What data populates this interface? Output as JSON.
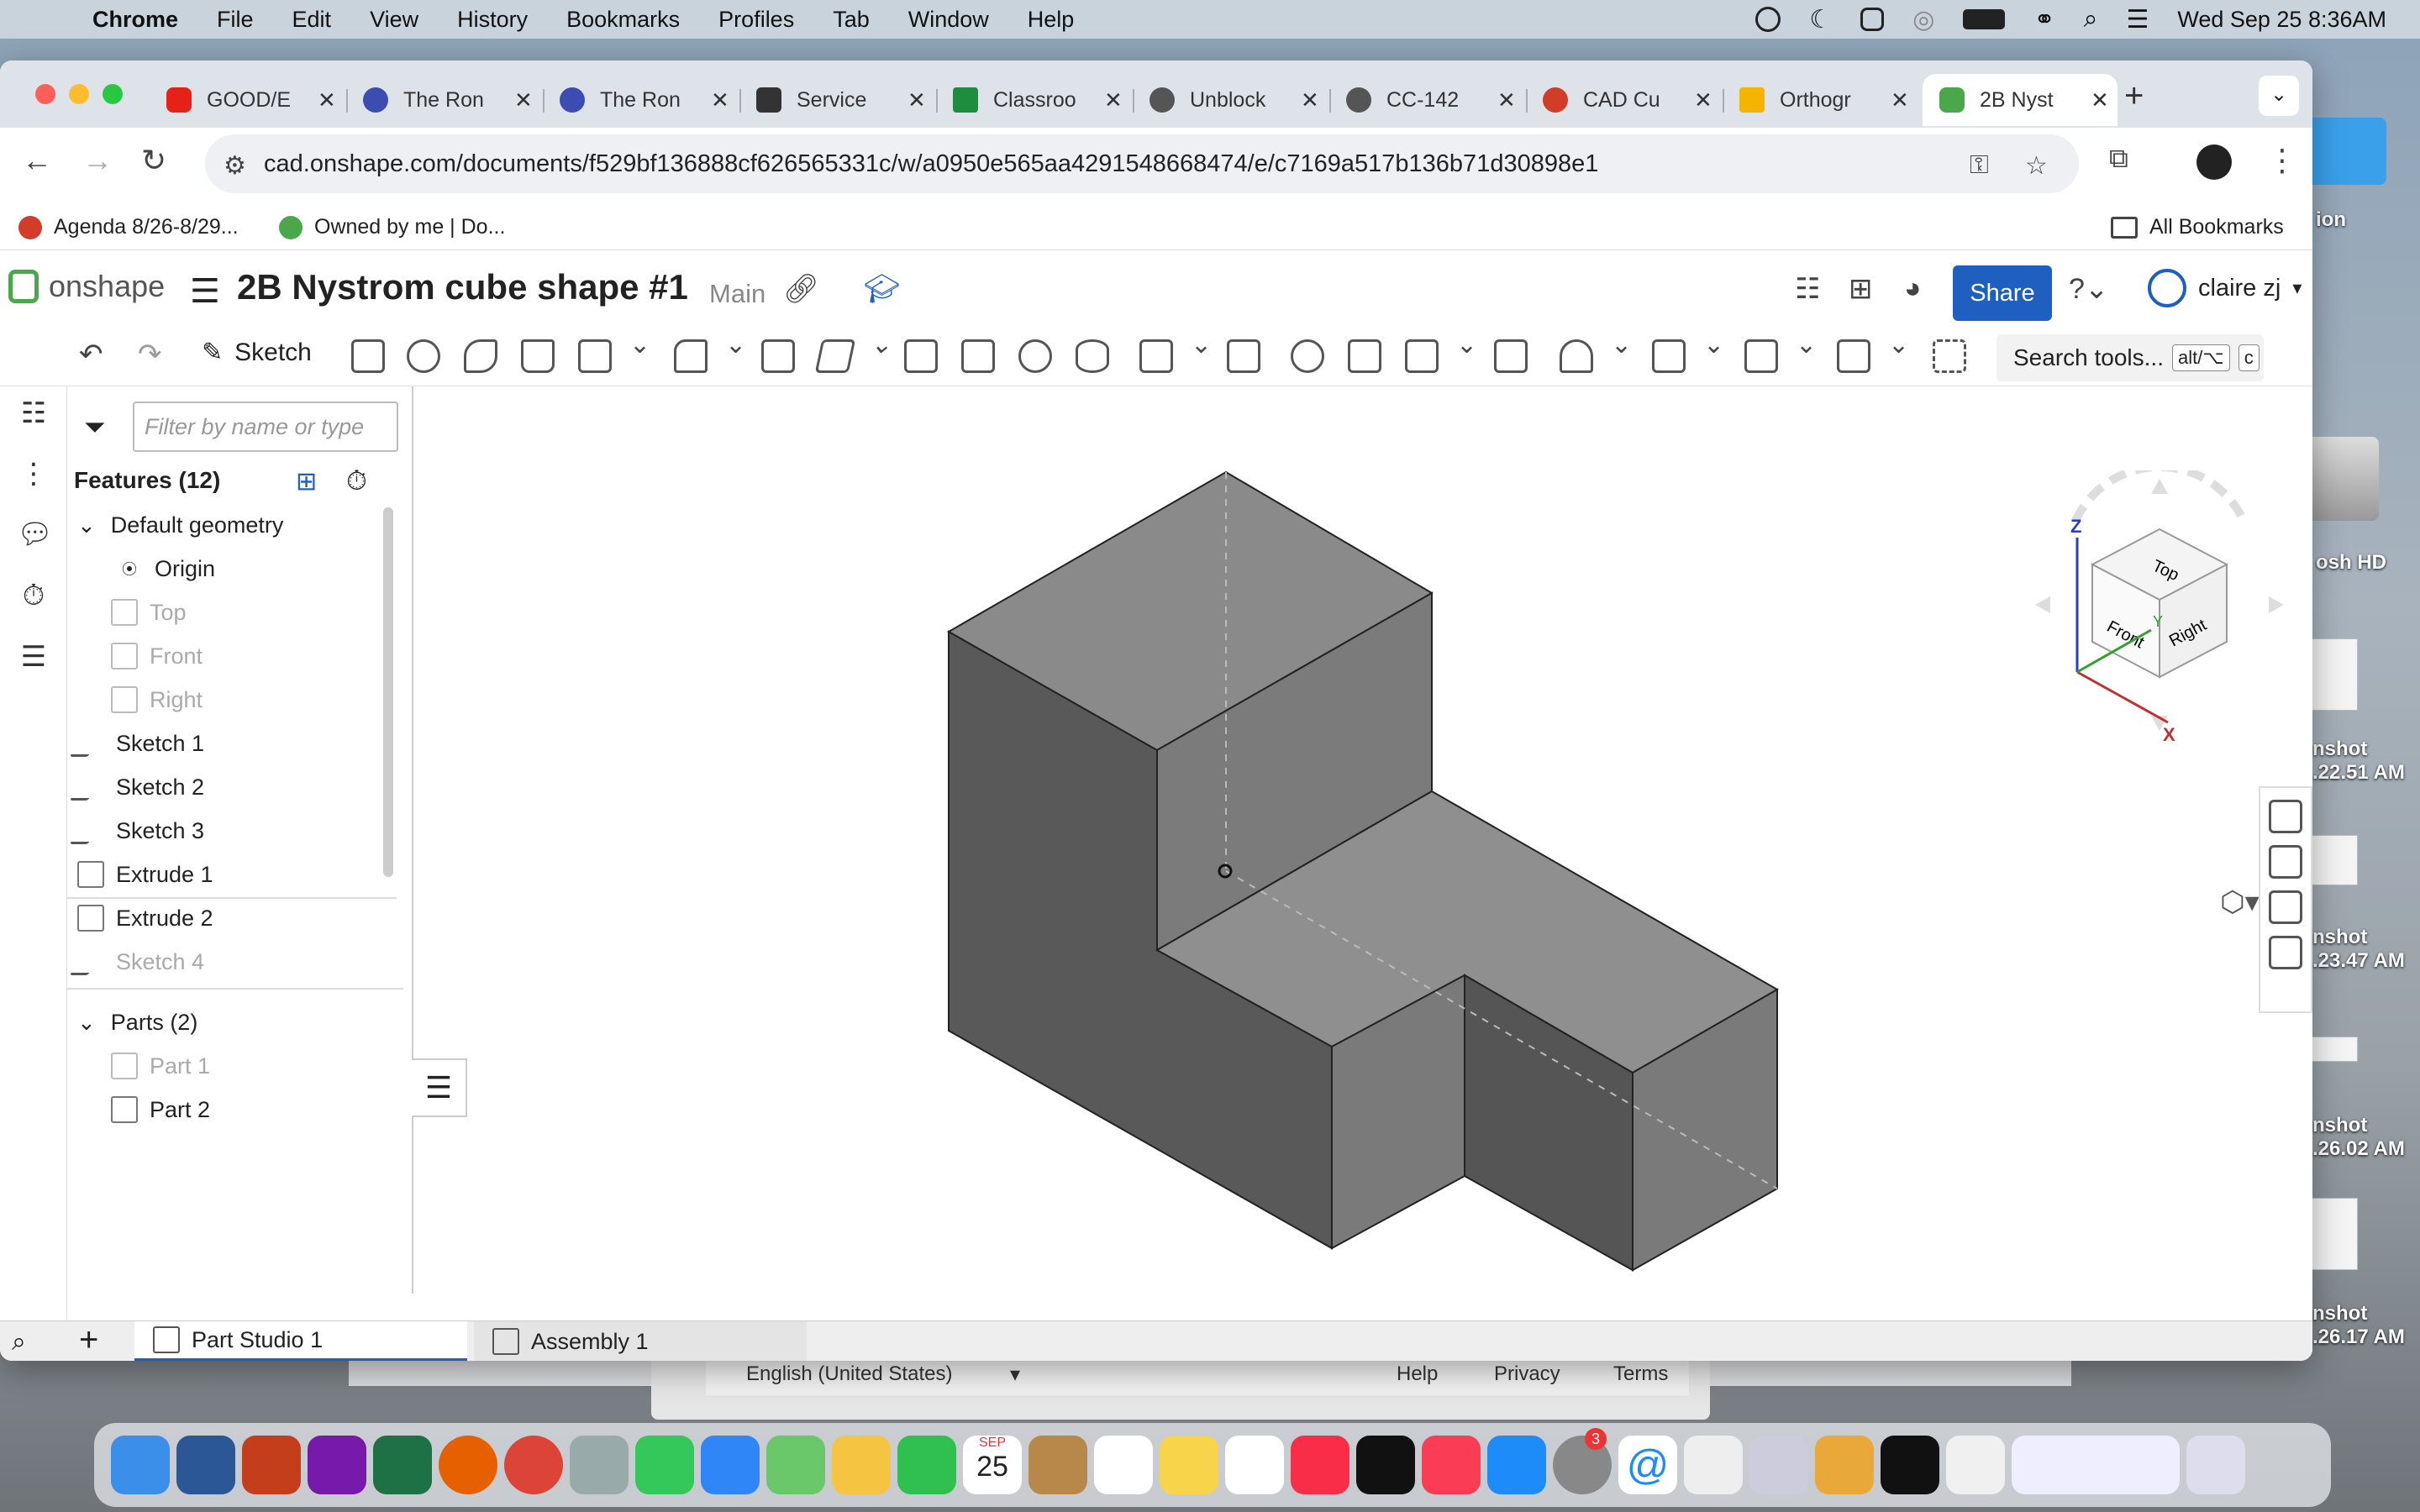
{
  "menubar": {
    "app_name": "Chrome",
    "items": [
      "File",
      "Edit",
      "View",
      "History",
      "Bookmarks",
      "Profiles",
      "Tab",
      "Window",
      "Help"
    ],
    "datetime": "Wed Sep 25  8:36AM"
  },
  "desktop": {
    "items": [
      {
        "label": "ion"
      },
      {
        "label": "osh HD"
      },
      {
        "label": "nshot\n.22.51 AM"
      },
      {
        "label": "nshot\n.23.47 AM"
      },
      {
        "label": "nshot\n.26.02 AM"
      },
      {
        "label": "nshot\n.26.17 AM"
      }
    ]
  },
  "behind_window": {
    "language": "English (United States)",
    "links": [
      "Help",
      "Privacy",
      "Terms"
    ]
  },
  "browser": {
    "tabs": [
      {
        "title": "GOOD/E",
        "color": "#e62117"
      },
      {
        "title": "The Ron",
        "color": "#3b4db0"
      },
      {
        "title": "The Ron",
        "color": "#3b4db0"
      },
      {
        "title": "Service",
        "color": "#333333"
      },
      {
        "title": "Classroo",
        "color": "#1e8e3e"
      },
      {
        "title": "Unblock",
        "color": "#555555"
      },
      {
        "title": "CC-142",
        "color": "#555555"
      },
      {
        "title": "CAD Cu",
        "color": "#d23c28"
      },
      {
        "title": "Orthogr",
        "color": "#f4b400"
      },
      {
        "title": "2B Nyst",
        "color": "#4aa84a"
      }
    ],
    "url": "cad.onshape.com/documents/f529bf136888cf626565331c/w/a0950e565aa4291548668474/e/c7169a517b136b71d30898e1",
    "bookmarks": [
      {
        "label": "Agenda 8/26-8/29...",
        "color": "#d23c28"
      },
      {
        "label": "Owned by me | Do...",
        "color": "#4aa84a"
      }
    ],
    "all_bookmarks": "All Bookmarks"
  },
  "onshape": {
    "logo": "onshape",
    "doc_title": "2B Nystrom cube shape #1",
    "branch": "Main",
    "share": "Share",
    "user": "claire zj",
    "sketch": "Sketch",
    "search_tools": "Search tools...",
    "search_kbd1": "alt/⌥",
    "search_kbd2": "c",
    "filter_placeholder": "Filter by name or type",
    "features_header": "Features (12)",
    "default_geometry": "Default geometry",
    "geometry": [
      "Origin",
      "Top",
      "Front",
      "Right"
    ],
    "features": [
      "Sketch 1",
      "Sketch 2",
      "Sketch 3",
      "Extrude 1",
      "Extrude 2",
      "Sketch 4"
    ],
    "parts_header": "Parts (2)",
    "parts": [
      "Part 1",
      "Part 2"
    ],
    "viewcube": {
      "top": "Top",
      "front": "Front",
      "right": "Right",
      "z": "Z",
      "x": "X",
      "y": "Y"
    },
    "bottom_tabs": [
      "Part Studio 1",
      "Assembly 1"
    ],
    "accent": "#1f5fbf"
  },
  "dock": {
    "calendar_month": "SEP",
    "calendar_day": "25",
    "settings_badge": "3"
  }
}
